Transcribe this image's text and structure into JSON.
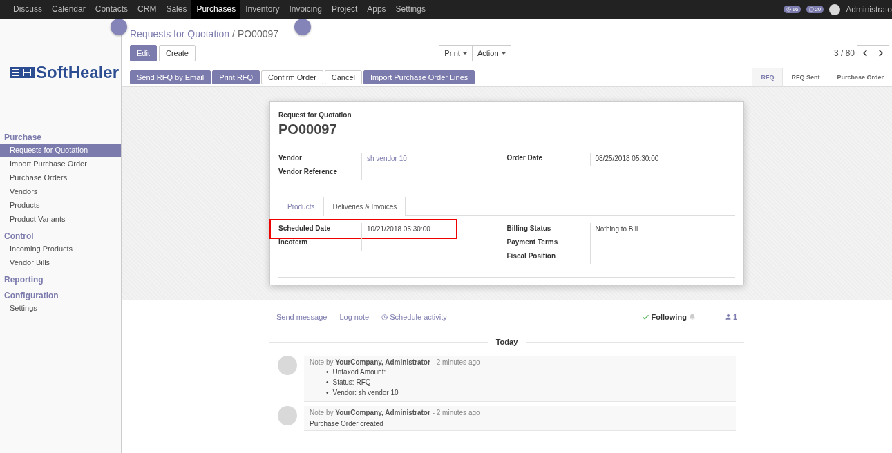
{
  "top_menu": [
    {
      "label": "Discuss",
      "selected": false
    },
    {
      "label": "Calendar",
      "selected": false
    },
    {
      "label": "Contacts",
      "selected": false
    },
    {
      "label": "CRM",
      "selected": false
    },
    {
      "label": "Sales",
      "selected": false
    },
    {
      "label": "Purchases",
      "selected": true
    },
    {
      "label": "Inventory",
      "selected": false
    },
    {
      "label": "Invoicing",
      "selected": false
    },
    {
      "label": "Project",
      "selected": false
    },
    {
      "label": "Apps",
      "selected": false
    },
    {
      "label": "Settings",
      "selected": false
    }
  ],
  "systray": {
    "activity_count": "16",
    "message_count": "20",
    "user": "Administrato"
  },
  "logo": {
    "text": "SoftHealer"
  },
  "sidebar": [
    {
      "heading": "Purchase",
      "items": [
        {
          "label": "Requests for Quotation",
          "selected": true
        },
        {
          "label": "Import Purchase Order",
          "selected": false
        },
        {
          "label": "Purchase Orders",
          "selected": false
        },
        {
          "label": "Vendors",
          "selected": false
        },
        {
          "label": "Products",
          "selected": false
        },
        {
          "label": "Product Variants",
          "selected": false
        }
      ]
    },
    {
      "heading": "Control",
      "items": [
        {
          "label": "Incoming Products",
          "selected": false
        },
        {
          "label": "Vendor Bills",
          "selected": false
        }
      ]
    },
    {
      "heading": "Reporting"
    },
    {
      "heading": "Configuration",
      "items": [
        {
          "label": "Settings",
          "selected": false
        }
      ]
    }
  ],
  "breadcrumb": {
    "parent": "Requests for Quotation",
    "separator": "/",
    "current": "PO00097"
  },
  "main_buttons": [
    {
      "label": "Edit",
      "kind": "primary"
    },
    {
      "label": "Create",
      "kind": "default"
    }
  ],
  "dropdowns": [
    "Print",
    "Action"
  ],
  "pager": {
    "text": "3 / 80"
  },
  "header_buttons": [
    {
      "label": "Send RFQ by Email",
      "kind": "primary"
    },
    {
      "label": "Print RFQ",
      "kind": "primary"
    },
    {
      "label": "Confirm Order",
      "kind": "default"
    },
    {
      "label": "Cancel",
      "kind": "default"
    },
    {
      "label": "Import Purchase Order Lines",
      "kind": "primary"
    }
  ],
  "status_bar": [
    {
      "label": "RFQ",
      "selected": true
    },
    {
      "label": "RFQ Sent",
      "selected": false
    },
    {
      "label": "Purchase Order",
      "selected": false
    }
  ],
  "form": {
    "subtitle": "Request for Quotation",
    "title": "PO00097",
    "left_fields": [
      {
        "label": "Vendor",
        "value": "sh vendor 10",
        "kind": "link"
      },
      {
        "label": "Vendor Reference",
        "kind": "text"
      }
    ],
    "right_fields": [
      {
        "label": "Order Date",
        "value": "08/25/2018 05:30:00",
        "kind": "text"
      }
    ],
    "tabs": [
      {
        "label": "Products",
        "selected": false
      },
      {
        "label": "Deliveries & Invoices",
        "selected": true
      }
    ],
    "tab_left_fields": [
      {
        "label": "Scheduled Date",
        "value": "10/21/2018 05:30:00",
        "kind": "text",
        "highlighted": true
      },
      {
        "label": "Incoterm",
        "kind": "text",
        "highlighted": false
      }
    ],
    "tab_right_fields": [
      {
        "label": "Billing Status",
        "value": "Nothing to Bill",
        "kind": "text"
      },
      {
        "label": "Payment Terms",
        "kind": "text"
      },
      {
        "label": "Fiscal Position",
        "kind": "text"
      }
    ]
  },
  "chatter": {
    "actions": [
      {
        "label": "Send message",
        "kind": "plain"
      },
      {
        "label": "Log note",
        "kind": "plain"
      },
      {
        "label": "Schedule activity",
        "kind": "clock"
      }
    ],
    "following": "Following",
    "followers": "1",
    "day": "Today",
    "messages": [
      {
        "header": "Note by **YourCompany, Administrator** - 2 minutes ago",
        "bullet": "•",
        "bullets": [
          "Untaxed Amount:",
          "Status: RFQ",
          "Vendor: sh vendor 10"
        ]
      },
      {
        "header": "Note by **YourCompany, Administrator** - 2 minutes ago",
        "text": "Purchase Order created"
      }
    ]
  }
}
